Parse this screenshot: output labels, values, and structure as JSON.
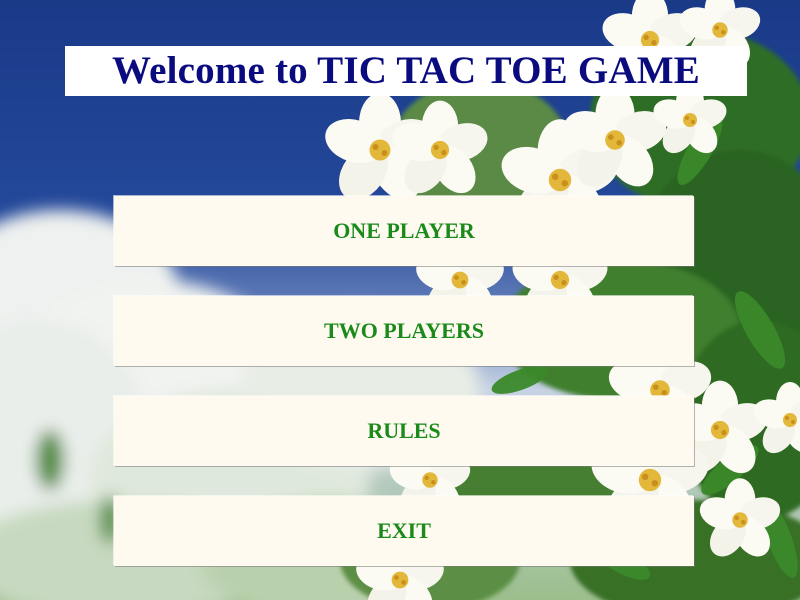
{
  "title": "Welcome to TIC TAC TOE GAME",
  "menu": {
    "one_player": "ONE PLAYER",
    "two_players": "TWO PLAYERS",
    "rules": "RULES",
    "exit": "EXIT"
  },
  "colors": {
    "title_text": "#0b0b80",
    "button_text": "#1a8a1a",
    "button_bg": "#fffaf0",
    "sky": "#1e3f8a",
    "leaves": "#2f7a2a"
  },
  "background": "jasmine-flowers-sky-photo"
}
